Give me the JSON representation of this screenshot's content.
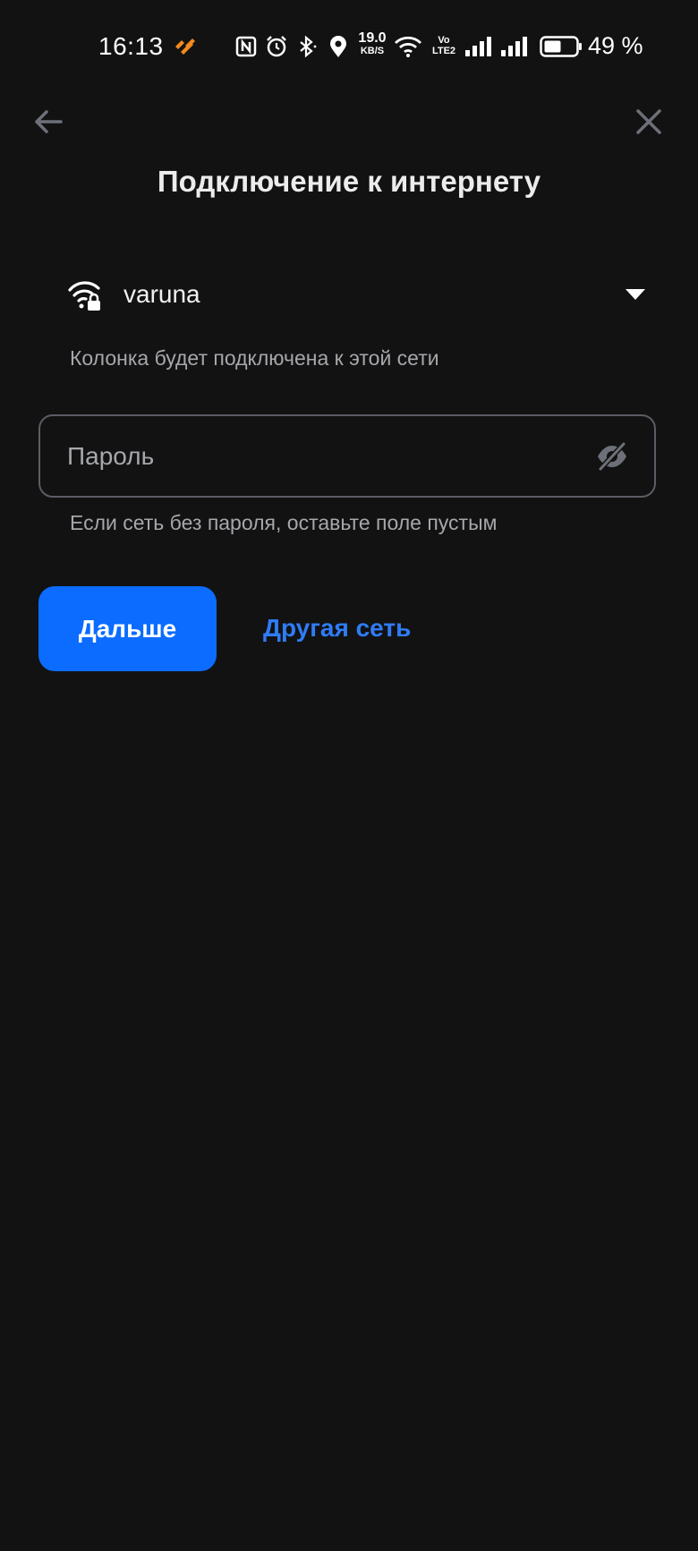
{
  "status_bar": {
    "time": "16:13",
    "net_speed_value": "19.0",
    "net_speed_unit": "KB/S",
    "volte_label_top": "Vo",
    "volte_label_bottom": "LTE2",
    "battery_percent": "49 %",
    "icons": [
      "app-notification-icon",
      "nfc-icon",
      "alarm-icon",
      "bluetooth-icon",
      "location-icon",
      "wifi-icon",
      "signal-icon",
      "signal-icon",
      "battery-icon"
    ],
    "accent_color": "#f28a1d"
  },
  "nav": {
    "back_icon": "arrow-left-icon",
    "close_icon": "close-icon"
  },
  "title": "Подключение к интернету",
  "network": {
    "ssid": "varuna",
    "icon": "wifi-lock-icon",
    "dropdown_icon": "caret-down-icon",
    "hint": "Колонка будет подключена к этой сети"
  },
  "password": {
    "placeholder": "Пароль",
    "value": "",
    "toggle_icon": "eye-off-icon",
    "hint": "Если сеть без пароля, оставьте поле пустым"
  },
  "actions": {
    "next_label": "Дальше",
    "other_network_label": "Другая сеть"
  },
  "colors": {
    "background": "#121213",
    "primary": "#0b6cff",
    "link": "#2f7cf6",
    "muted_text": "#a6a7ab"
  }
}
